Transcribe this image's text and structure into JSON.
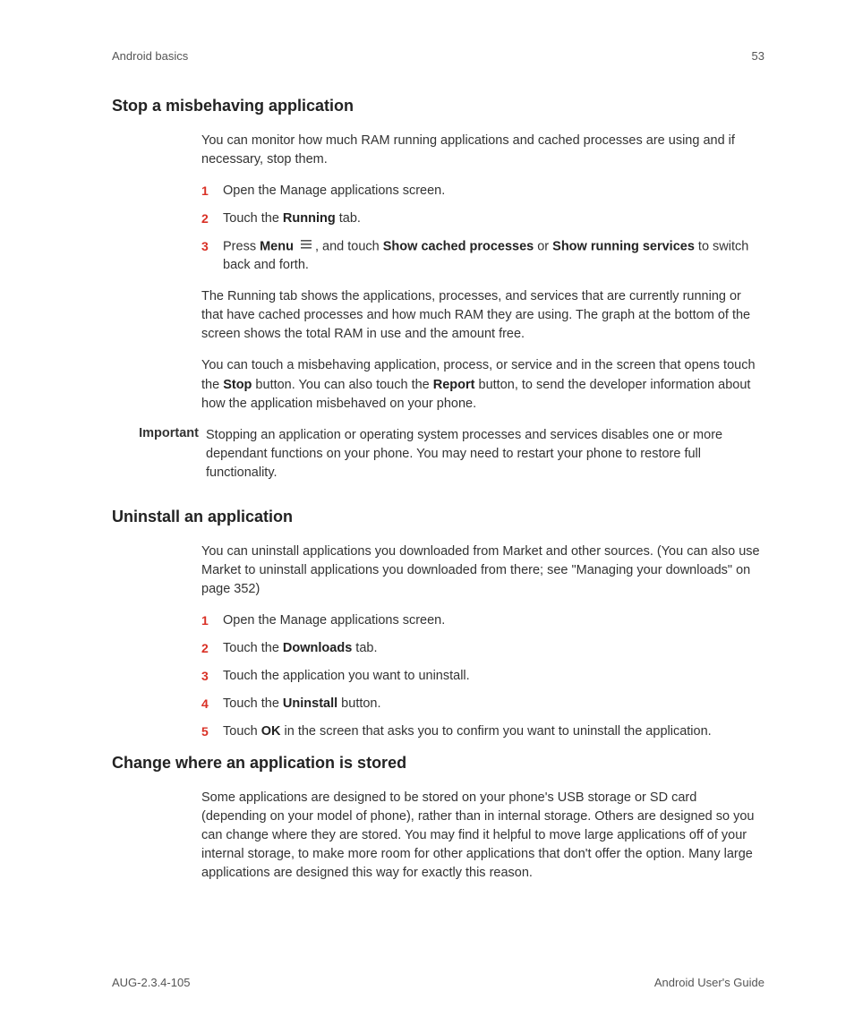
{
  "header": {
    "left": "Android basics",
    "right": "53"
  },
  "section1": {
    "title": "Stop a misbehaving application",
    "intro": "You can monitor how much RAM running applications and cached processes are using and if necessary, stop them.",
    "steps": {
      "s1": "Open the Manage applications screen.",
      "s2_a": "Touch the ",
      "s2_b": "Running",
      "s2_c": " tab.",
      "s3_a": "Press ",
      "s3_b": "Menu",
      "s3_c": ", and touch ",
      "s3_d": "Show cached processes",
      "s3_e": " or ",
      "s3_f": "Show running services",
      "s3_g": " to switch back and forth."
    },
    "p2": "The Running tab shows the applications, processes, and services that are currently running or that have cached processes and how much RAM they are using. The graph at the bottom of the screen shows the total RAM in use and the amount free.",
    "p3_a": "You can touch a misbehaving application, process, or service and in the screen that opens touch the ",
    "p3_b": "Stop",
    "p3_c": " button. You can also touch the ",
    "p3_d": "Report",
    "p3_e": " button, to send the developer information about how the application misbehaved on your phone.",
    "important_label": "Important",
    "important_body": "Stopping an application or operating system processes and services disables one or more dependant functions on your phone. You may need to restart your phone to restore full functionality."
  },
  "section2": {
    "title": "Uninstall an application",
    "intro": "You can uninstall applications you downloaded from Market and other sources. (You can also use Market to uninstall applications you downloaded from there; see \"Managing your downloads\" on page 352)",
    "steps": {
      "s1": "Open the Manage applications screen.",
      "s2_a": "Touch the ",
      "s2_b": "Downloads",
      "s2_c": " tab.",
      "s3": "Touch the application you want to uninstall.",
      "s4_a": "Touch the ",
      "s4_b": "Uninstall",
      "s4_c": " button.",
      "s5_a": "Touch ",
      "s5_b": "OK",
      "s5_c": " in the screen that asks you to confirm you want to uninstall the application."
    }
  },
  "section3": {
    "title": "Change where an application is stored",
    "intro": "Some applications are designed to be stored on your phone's USB storage or SD card (depending on your model of phone), rather than in internal storage. Others are designed so you can change where they are stored. You may find it helpful to move large applications off of your internal storage, to make more room for other applications that don't offer the option. Many large applications are designed this way for exactly this reason."
  },
  "footer": {
    "left": "AUG-2.3.4-105",
    "right": "Android User's Guide"
  },
  "nums": {
    "n1": "1",
    "n2": "2",
    "n3": "3",
    "n4": "4",
    "n5": "5"
  }
}
